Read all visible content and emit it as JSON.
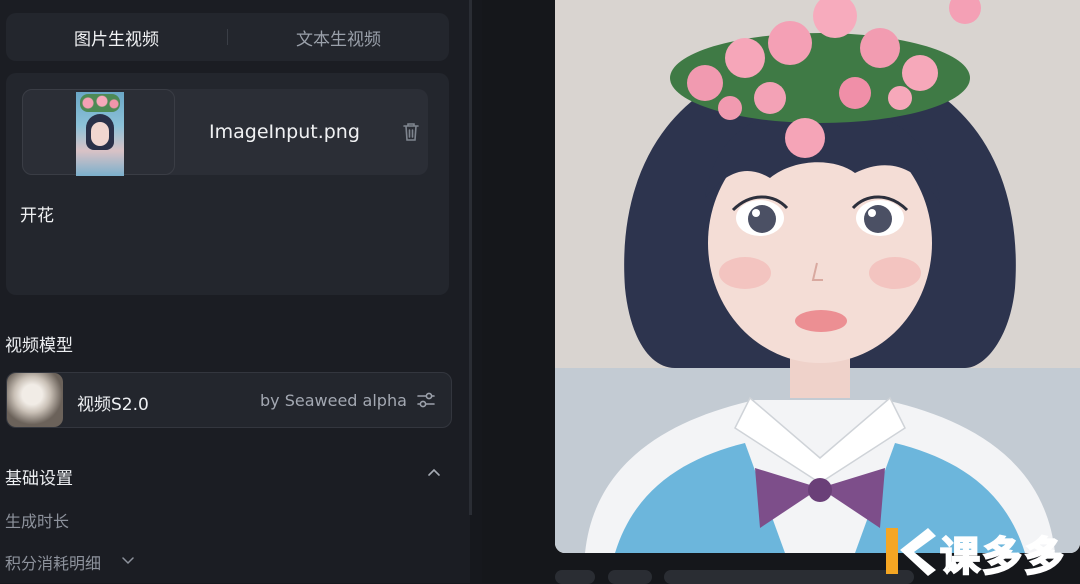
{
  "tabs": [
    {
      "label": "图片生视频",
      "active": true
    },
    {
      "label": "文本生视频",
      "active": false
    }
  ],
  "input": {
    "file_name": "ImageInput.png",
    "prompt": "开花"
  },
  "model_section": {
    "title": "视频模型",
    "model_name": "视频S2.0",
    "model_by": "by Seaweed alpha"
  },
  "basic_settings": {
    "title": "基础设置",
    "duration_label": "生成时长",
    "points_label": "积分消耗明细"
  },
  "watermark": {
    "text": "课多多"
  },
  "colors": {
    "background": "#16181d",
    "panel": "#23262d",
    "text_primary": "#f0f1f3",
    "text_muted": "#8d929c"
  },
  "icons": {
    "delete": "trash-icon",
    "model_settings": "sliders-icon",
    "collapse": "chevron-up-icon",
    "expand": "chevron-down-icon"
  }
}
